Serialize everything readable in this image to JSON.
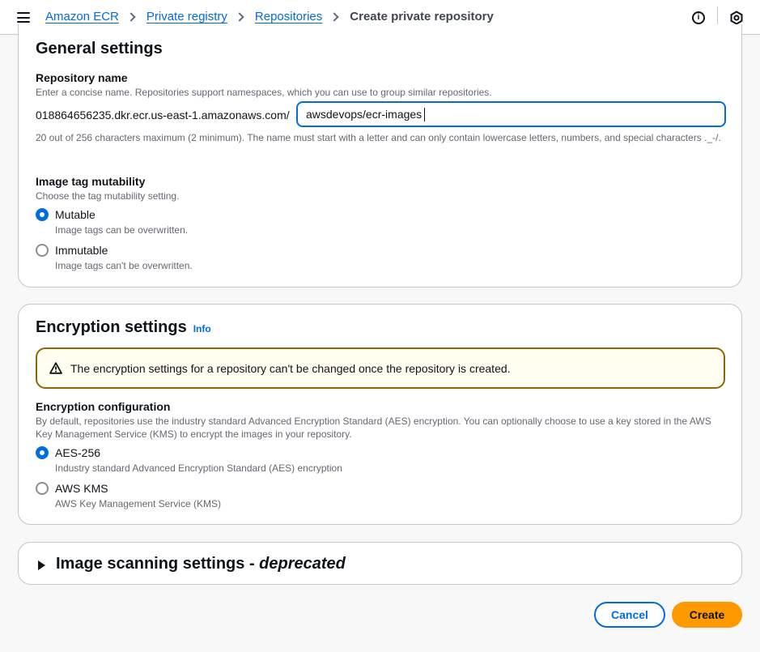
{
  "breadcrumbs": {
    "items": [
      "Amazon ECR",
      "Private registry",
      "Repositories"
    ],
    "current": "Create private repository"
  },
  "topbar": {
    "info_icon": "info-circle-icon",
    "notifications_icon": "hexagon-icon"
  },
  "general": {
    "title": "General settings",
    "repo_name_label": "Repository name",
    "repo_name_desc": "Enter a concise name. Repositories support namespaces, which you can use to group similar repositories.",
    "prefix": "018864656235.dkr.ecr.us-east-1.amazonaws.com/",
    "repo_name_value": "awsdevops/ecr-images",
    "constraint": "20 out of 256 characters maximum (2 minimum). The name must start with a letter and can only contain lowercase letters, numbers, and special characters ._-/.",
    "mutability_label": "Image tag mutability",
    "mutability_desc": "Choose the tag mutability setting.",
    "options": [
      {
        "label": "Mutable",
        "desc": "Image tags can be overwritten.",
        "checked": true
      },
      {
        "label": "Immutable",
        "desc": "Image tags can't be overwritten.",
        "checked": false
      }
    ]
  },
  "encryption": {
    "title": "Encryption settings",
    "info": "Info",
    "alert": "The encryption settings for a repository can't be changed once the repository is created.",
    "config_label": "Encryption configuration",
    "config_desc": "By default, repositories use the industry standard Advanced Encryption Standard (AES) encryption. You can optionally choose to use a key stored in the AWS Key Management Service (KMS) to encrypt the images in your repository.",
    "options": [
      {
        "label": "AES-256",
        "desc": "Industry standard Advanced Encryption Standard (AES) encryption",
        "checked": true
      },
      {
        "label": "AWS KMS",
        "desc": "AWS Key Management Service (KMS)",
        "checked": false
      }
    ]
  },
  "scanning": {
    "title": "Image scanning settings - ",
    "title_italic": "deprecated"
  },
  "actions": {
    "cancel": "Cancel",
    "create": "Create"
  },
  "colors": {
    "link": "#006ce0",
    "primary_button": "#ff9900",
    "warning_border": "#8d6605",
    "warning_bg": "#fffef0"
  }
}
